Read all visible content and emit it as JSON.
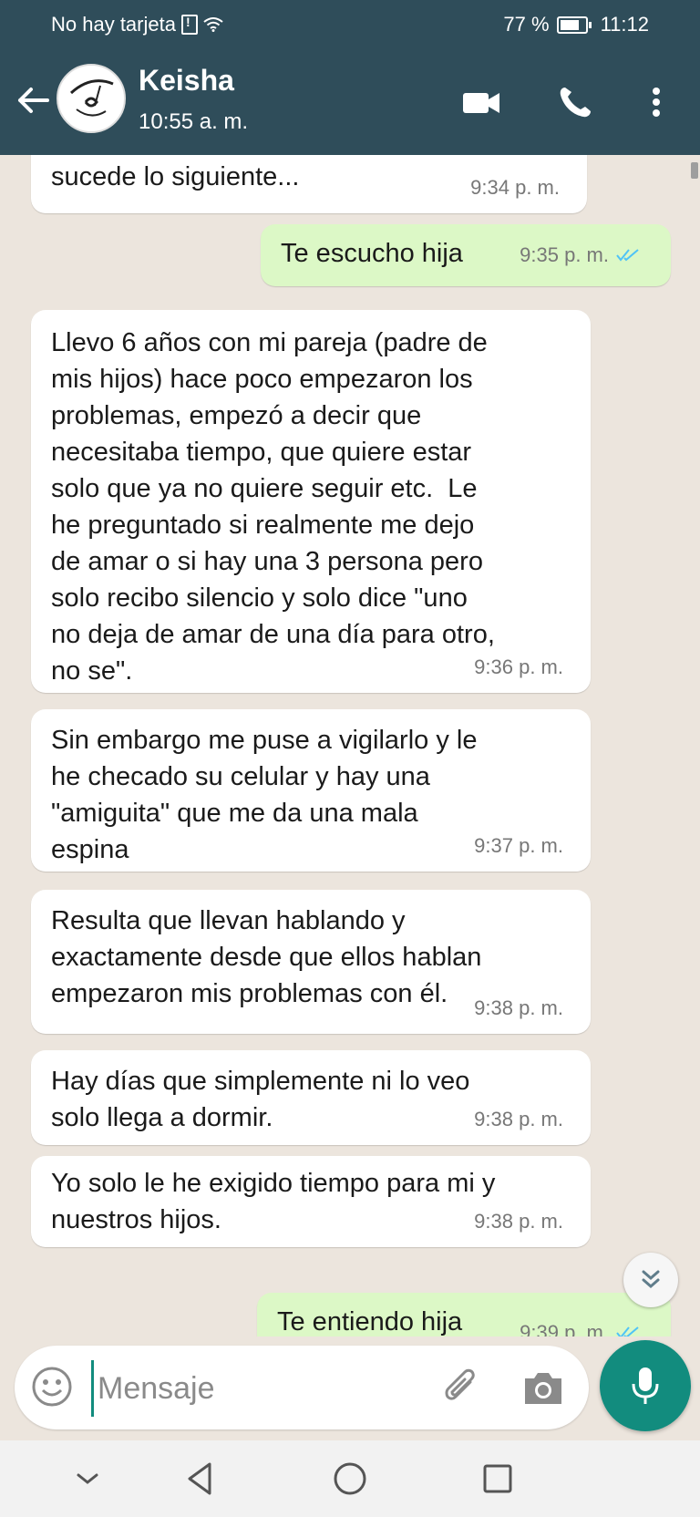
{
  "status_bar": {
    "carrier": "No hay tarjeta",
    "battery": "77 %",
    "time": "11:12"
  },
  "header": {
    "contact_name": "Keisha",
    "contact_status": "10:55 a. m.",
    "icons": [
      "back-arrow-icon",
      "video-call-icon",
      "phone-icon",
      "more-vert-icon"
    ]
  },
  "messages": [
    {
      "direction": "in",
      "text": "sucede lo siguiente...",
      "time": "9:34 p. m."
    },
    {
      "direction": "out",
      "text": "Te escucho hija",
      "time": "9:35 p. m.",
      "read": true
    },
    {
      "direction": "in",
      "text": "Llevo 6 años con mi pareja (padre de\nmis hijos) hace poco empezaron los\nproblemas, empezó a decir que\nnecesitaba tiempo, que quiere estar\nsolo que ya no quiere seguir etc.  Le\nhe preguntado si realmente me dejo\nde amar o si hay una 3 persona pero\nsolo recibo silencio y solo dice \"uno\nno deja de amar de una día para otro,\nno se\".",
      "time": "9:36 p. m."
    },
    {
      "direction": "in",
      "text": "Sin embargo me puse a vigilarlo y le\nhe checado su celular y hay una\n\"amiguita\" que me da una mala\nespina",
      "time": "9:37 p. m."
    },
    {
      "direction": "in",
      "text": "Resulta que llevan hablando y\nexactamente desde que ellos hablan\nempezaron mis problemas con él.",
      "time": "9:38 p. m."
    },
    {
      "direction": "in",
      "text": "Hay días que simplemente ni lo veo\nsolo llega a dormir.",
      "time": "9:38 p. m."
    },
    {
      "direction": "in",
      "text": "Yo solo le he exigido tiempo para mi y\nnuestros hijos.",
      "time": "9:38 p. m."
    },
    {
      "direction": "out",
      "text": "Te entiendo hija",
      "time": "9:39 p. m.",
      "read": true
    }
  ],
  "composer": {
    "placeholder": "Mensaje"
  },
  "colors": {
    "header": "#2f4d5a",
    "chat_bg": "#ece5dd",
    "outgoing_bubble": "#dcf8c6",
    "accent": "#128c7e",
    "read_ticks": "#4fc3f7"
  }
}
